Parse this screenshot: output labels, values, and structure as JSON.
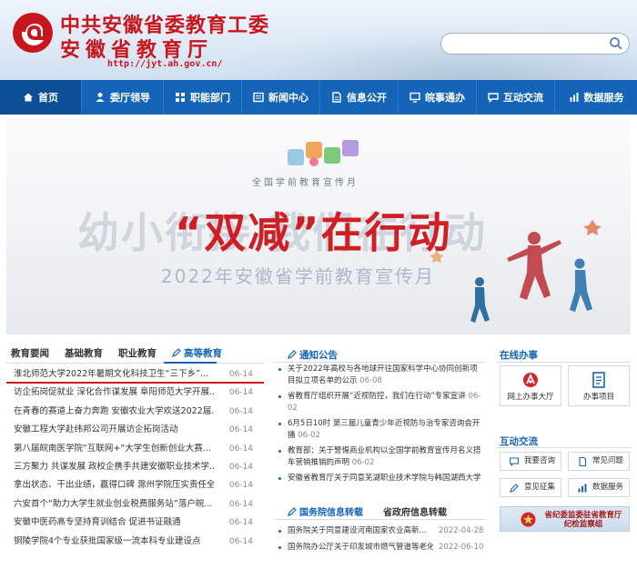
{
  "header": {
    "title_line1": "中共安徽省委教育工委",
    "title_line2": "安徽省教育厅",
    "url": "http://jyt.ah.gov.cn/",
    "search_placeholder": ""
  },
  "nav": {
    "items": [
      {
        "label": "首页",
        "icon": "home-icon"
      },
      {
        "label": "委厅领导",
        "icon": "leader-icon"
      },
      {
        "label": "职能部门",
        "icon": "org-icon"
      },
      {
        "label": "新闻中心",
        "icon": "news-icon"
      },
      {
        "label": "信息公开",
        "icon": "info-icon"
      },
      {
        "label": "皖事通办",
        "icon": "service-icon"
      },
      {
        "label": "互动交流",
        "icon": "chat-icon"
      },
      {
        "label": "数据服务",
        "icon": "data-icon"
      }
    ]
  },
  "banner": {
    "subtitle": "全国学前教育宣传月",
    "ghost_text": "幼小衔接 我们在行动",
    "main_text": "“双减”在行动",
    "month_text": "2022年安徽省学前教育宣传月"
  },
  "news_tabs": [
    "教育要闻",
    "基础教育",
    "职业教育",
    "高等教育"
  ],
  "news": [
    {
      "title": "淮北师范大学2022年暑期文化科技卫生“三下乡”...",
      "date": "06-14"
    },
    {
      "title": "访企拓岗促就业 深化合作谋发展 阜阳师范大学开展...",
      "date": "06-14"
    },
    {
      "title": "在青春的赛道上奋力奔跑 安徽农业大学欢送2022届...",
      "date": "06-14"
    },
    {
      "title": "安徽工程大学赴纬邦公司开展访企拓岗活动",
      "date": "06-14"
    },
    {
      "title": "第八届皖南医学院“互联网+”大学生创新创业大赛...",
      "date": "06-14"
    },
    {
      "title": "三方聚力 共谋发展 政校企携手共建安徽职业技术学...",
      "date": "06-14"
    },
    {
      "title": "拿出状态、干出业绩，赢得口碑 滁州学院压实责任全...",
      "date": "06-14"
    },
    {
      "title": "六安首个“助力大学生就业创业税费服务站”落户皖...",
      "date": "06-14"
    },
    {
      "title": "安徽中医药高专坚持育训结合 促进书证融通",
      "date": "06-14"
    },
    {
      "title": "铜陵学院4个专业获批国家级一流本科专业建设点",
      "date": "06-14"
    }
  ],
  "notices": {
    "heading": "通知公告",
    "items": [
      {
        "title": "关于2022年高校与各地球开往国家科学中心协同创新项目拟立项名单的公示",
        "date": "06-08"
      },
      {
        "title": "省教育厅组织开展“近视防控，我们在行动”专家宣讲",
        "date": "06-02"
      },
      {
        "title": "6月5日10时 第三届儿童青少年近视防与治专家咨询会开播",
        "date": "06-02"
      },
      {
        "title": "教育部：关于警惕商业机构以全国学前教育宣传月名义搭车营销推销的声明",
        "date": "06-02"
      },
      {
        "title": "安徽省教育厅关于同意芜湖职业技术学院与韩国湖西大学",
        "date": ""
      }
    ]
  },
  "gov_tabs": [
    "国务院信息转载",
    "省政府信息转载"
  ],
  "gov_news": [
    {
      "title": "国务院关于同意建设河南国家农业高新...",
      "date": "2022-04-28"
    },
    {
      "title": "国务院办公厅关于印发城市燃气管道等老化...",
      "date": "2022-06-10"
    }
  ],
  "online": {
    "heading": "在线办事",
    "cards": [
      {
        "label": "网上办事大厅",
        "icon": "hall-icon"
      },
      {
        "label": "办事项目",
        "icon": "project-icon"
      }
    ]
  },
  "interact": {
    "heading": "互动交流",
    "items": [
      {
        "label": "我要咨询",
        "icon": "consult-icon"
      },
      {
        "label": "常见问题",
        "icon": "faq-icon"
      },
      {
        "label": "意见征集",
        "icon": "survey-icon"
      },
      {
        "label": "数据服务",
        "icon": "data-service-icon"
      }
    ]
  },
  "jiwei": {
    "line1": "省纪委监委驻省教育厅",
    "line2": "纪检监察组"
  }
}
